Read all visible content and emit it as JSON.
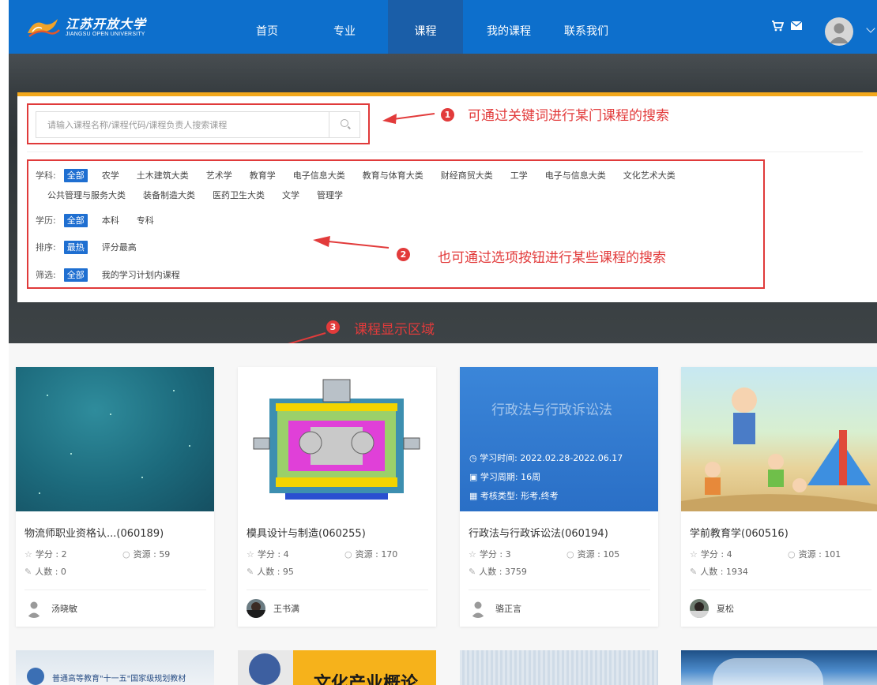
{
  "header": {
    "logo_cn": "江苏开放大学",
    "logo_en": "JIANGSU OPEN UNIVERSITY",
    "nav": [
      "首页",
      "专业",
      "课程",
      "我的课程",
      "联系我们"
    ],
    "active_nav": "课程"
  },
  "search": {
    "placeholder": "请输入课程名称/课程代码/课程负责人搜索课程"
  },
  "filters": {
    "subject_label": "学科:",
    "subjects_row1": [
      "全部",
      "农学",
      "土木建筑大类",
      "艺术学",
      "教育学",
      "电子信息大类",
      "教育与体育大类",
      "财经商贸大类",
      "工学",
      "电子与信息大类",
      "文化艺术大类"
    ],
    "subjects_row2": [
      "公共管理与服务大类",
      "装备制造大类",
      "医药卫生大类",
      "文学",
      "管理学"
    ],
    "edu_label": "学历:",
    "edu": [
      "全部",
      "本科",
      "专科"
    ],
    "sort_label": "排序:",
    "sort": [
      "最热",
      "评分最高"
    ],
    "screen_label": "筛选:",
    "screen": [
      "全部",
      "我的学习计划内课程"
    ]
  },
  "annotations": {
    "n1": "1",
    "n1_text": "可通过关键词进行某门课程的搜索",
    "n2": "2",
    "n2_text": "也可通过选项按钮进行某些课程的搜索",
    "n3": "3",
    "n3_text": "课程显示区域"
  },
  "labels": {
    "credit": "学分",
    "resource": "资源",
    "people": "人数"
  },
  "courses": [
    {
      "title": "物流师职业资格认...(060189)",
      "credit": "2",
      "resource": "59",
      "people": "0",
      "teacher": "汤晓敏"
    },
    {
      "title": "模具设计与制造(060255)",
      "credit": "4",
      "resource": "170",
      "people": "95",
      "teacher": "王书满"
    },
    {
      "title": "行政法与行政诉讼法(060194)",
      "credit": "3",
      "resource": "105",
      "people": "3759",
      "teacher": "骆正言",
      "overlay": {
        "banner": "行政法与行政诉讼法",
        "study_time": "学习时间: 2022.02.28-2022.06.17",
        "period": "学习周期: 16周",
        "exam": "考核类型: 形考,终考"
      }
    },
    {
      "title": "学前教育学(060516)",
      "credit": "4",
      "resource": "101",
      "people": "1934",
      "teacher": "夏松"
    }
  ],
  "bottom_cards": {
    "c1_text": "普通高等教育\"十一五\"国家级规划教材",
    "c2_text": "文化产业概论"
  },
  "colors": {
    "header_blue": "#0d6fcc",
    "active_blue": "#1a5ea8",
    "accent_orange": "#f3a81b",
    "select_blue": "#1f6fd1",
    "annotation_red": "#e03a3a"
  }
}
